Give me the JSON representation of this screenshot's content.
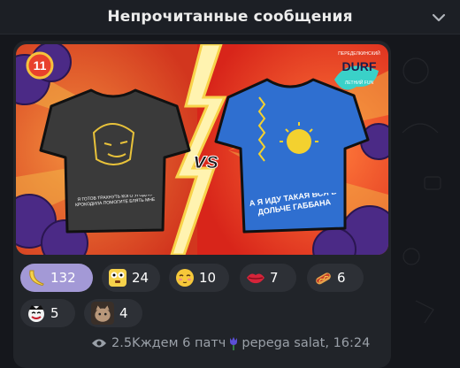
{
  "banner": {
    "title": "Непрочитанные сообщения",
    "chevron_icon": "chevron-down-icon"
  },
  "post": {
    "image": {
      "badge": "11",
      "brand_top": "ПЕРЕДЕЛКИНСКИЙ",
      "brand": "DURF",
      "brand_sub": "ЛЕТНИЙ FUN",
      "vs": "vs",
      "left_shirt_text": "Я ГОТОВ ТРАХНУТЬ КОГО УГОДНО КРОКОДИЛА ПОМОГИТЕ БЛЯТЬ МНЕ",
      "right_shirt_text": "А Я ИДУ ТАКАЯ ВСЯ В ДОЛЬЧЕ ГАББАНА"
    },
    "reactions": [
      {
        "emoji": "banana-icon",
        "count": "132",
        "active": true
      },
      {
        "emoji": "surprised-face-icon",
        "count": "24",
        "active": false
      },
      {
        "emoji": "blushing-face-icon",
        "count": "10",
        "active": false
      },
      {
        "emoji": "lips-icon",
        "count": "7",
        "active": false
      },
      {
        "emoji": "hotdog-icon",
        "count": "6",
        "active": false
      },
      {
        "emoji": "joker-icon",
        "count": "5",
        "active": false
      },
      {
        "emoji": "cat-photo-icon",
        "count": "4",
        "active": false
      }
    ],
    "footer": {
      "views": "2.5K",
      "signature_prefix": "ждем 6 патч",
      "signature_suffix": " pepega salat, 16:24",
      "tulip_icon": "tulip-icon",
      "eye_icon": "eye-icon"
    }
  }
}
